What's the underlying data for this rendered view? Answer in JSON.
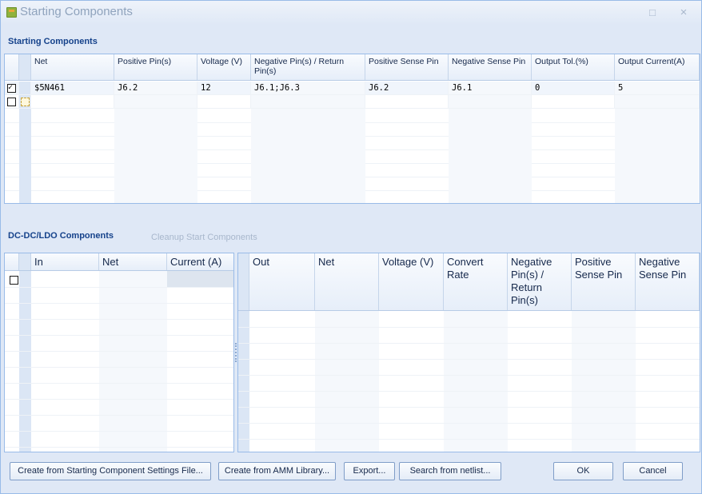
{
  "window": {
    "title": "Starting Components",
    "minimize": "□",
    "close": "×"
  },
  "starting": {
    "section_label": "Starting Components",
    "columns": [
      "Net",
      "Positive Pin(s)",
      "Voltage (V)",
      "Negative Pin(s) / Return Pin(s)",
      "Positive Sense Pin",
      "Negative Sense Pin",
      "Output Tol.(%)",
      "Output Current(A)"
    ],
    "rows": [
      {
        "checked": true,
        "cells": [
          "$5N461",
          "J6.2",
          "12",
          "J6.1;J6.3",
          "J6.2",
          "J6.1",
          "0",
          "5"
        ]
      }
    ]
  },
  "dcdc": {
    "section_label": "DC-DC/LDO Components",
    "cleanup_link": "Cleanup Start Components",
    "left_columns": [
      "In",
      "Net",
      "Current (A)"
    ],
    "right_columns": [
      "Out",
      "Net",
      "Voltage (V)",
      "Convert Rate",
      "Negative Pin(s) / Return Pin(s)",
      "Positive Sense Pin",
      "Negative Sense Pin"
    ]
  },
  "buttons": {
    "create_settings": "Create from Starting Component Settings File...",
    "create_amm": "Create from AMM Library...",
    "export": "Export...",
    "search_netlist": "Search from netlist...",
    "ok": "OK",
    "cancel": "Cancel"
  }
}
